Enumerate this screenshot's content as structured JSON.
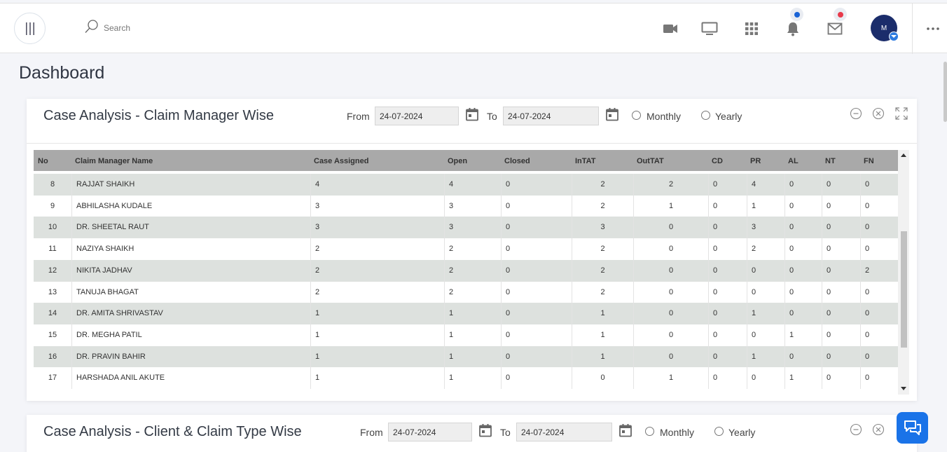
{
  "header": {
    "search_placeholder": "Search",
    "avatar_text": "M",
    "notification_dot_color": "#1a63d6",
    "mail_dot_color": "#e83a4a"
  },
  "page": {
    "title": "Dashboard"
  },
  "card1": {
    "title": "Case Analysis - Claim Manager Wise",
    "from_label": "From",
    "from_value": "24-07-2024",
    "to_label": "To",
    "to_value": "24-07-2024",
    "monthly_label": "Monthly",
    "yearly_label": "Yearly",
    "columns": [
      "No",
      "Claim Manager Name",
      "Case Assigned",
      "Open",
      "Closed",
      "InTAT",
      "OutTAT",
      "CD",
      "PR",
      "AL",
      "NT",
      "FN"
    ],
    "rows": [
      [
        "8",
        "RAJJAT SHAIKH",
        "4",
        "4",
        "0",
        "2",
        "2",
        "0",
        "4",
        "0",
        "0",
        "0"
      ],
      [
        "9",
        "ABHILASHA KUDALE",
        "3",
        "3",
        "0",
        "2",
        "1",
        "0",
        "1",
        "0",
        "0",
        "0"
      ],
      [
        "10",
        "DR. SHEETAL RAUT",
        "3",
        "3",
        "0",
        "3",
        "0",
        "0",
        "3",
        "0",
        "0",
        "0"
      ],
      [
        "11",
        "NAZIYA SHAIKH",
        "2",
        "2",
        "0",
        "2",
        "0",
        "0",
        "2",
        "0",
        "0",
        "0"
      ],
      [
        "12",
        "NIKITA JADHAV",
        "2",
        "2",
        "0",
        "2",
        "0",
        "0",
        "0",
        "0",
        "0",
        "2"
      ],
      [
        "13",
        "TANUJA BHAGAT",
        "2",
        "2",
        "0",
        "2",
        "0",
        "0",
        "0",
        "0",
        "0",
        "0"
      ],
      [
        "14",
        "DR. AMITA SHRIVASTAV",
        "1",
        "1",
        "0",
        "1",
        "0",
        "0",
        "1",
        "0",
        "0",
        "0"
      ],
      [
        "15",
        "DR. MEGHA PATIL",
        "1",
        "1",
        "0",
        "1",
        "0",
        "0",
        "0",
        "1",
        "0",
        "0"
      ],
      [
        "16",
        "DR. PRAVIN BAHIR",
        "1",
        "1",
        "0",
        "1",
        "0",
        "0",
        "1",
        "0",
        "0",
        "0"
      ],
      [
        "17",
        "HARSHADA ANIL AKUTE",
        "1",
        "1",
        "0",
        "0",
        "1",
        "0",
        "0",
        "1",
        "0",
        "0"
      ]
    ]
  },
  "card2": {
    "title": "Case Analysis - Client & Claim Type Wise",
    "from_label": "From",
    "from_value": "24-07-2024",
    "to_label": "To",
    "to_value": "24-07-2024",
    "monthly_label": "Monthly",
    "yearly_label": "Yearly"
  },
  "colors": {
    "header_row": "#a9a9a9",
    "alt_row": "#dde1de",
    "chat_button": "#1a73e8",
    "avatar": "#1b2d6b"
  }
}
